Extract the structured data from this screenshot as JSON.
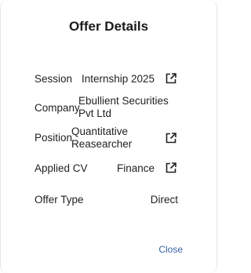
{
  "modal": {
    "title": "Offer Details",
    "close_label": "Close"
  },
  "rows": {
    "session": {
      "label": "Session",
      "value": "Internship 2025",
      "icon": "external-link-icon"
    },
    "company": {
      "label": "Company",
      "value_line1": "Ebullient Securities",
      "value_line2": "Pvt Ltd"
    },
    "position": {
      "label": "Position",
      "value_line1": "Quantitative",
      "value_line2": "Reasearcher",
      "icon": "external-link-icon"
    },
    "applied_cv": {
      "label": "Applied CV",
      "value": "Finance",
      "icon": "external-link-icon"
    },
    "offer_type": {
      "label": "Offer Type",
      "value": "Direct"
    }
  }
}
